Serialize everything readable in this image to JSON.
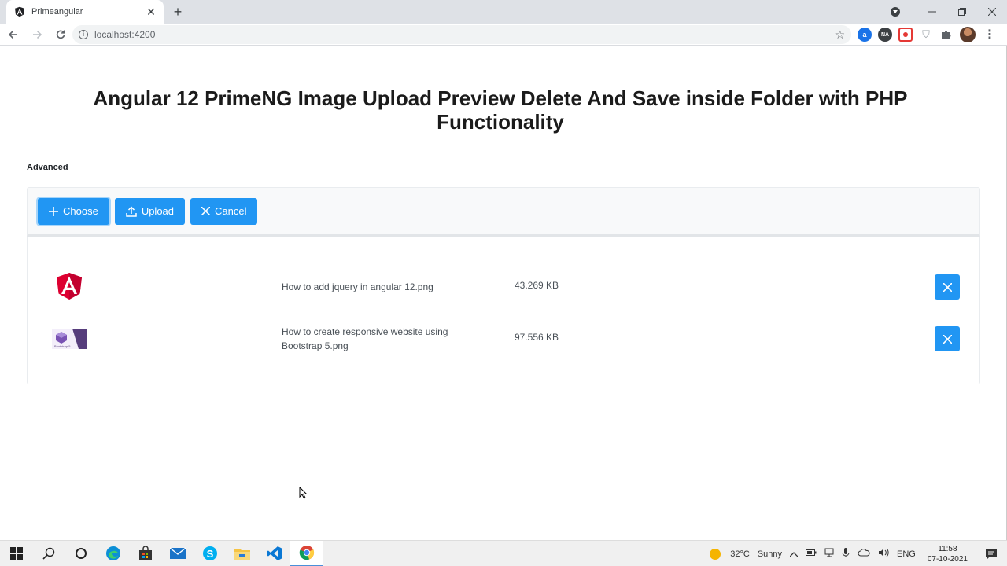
{
  "browser": {
    "tab_title": "Primeangular",
    "tab_close": "✕",
    "new_tab": "+",
    "url": "localhost:4200",
    "extensions": {
      "ext_a": "a",
      "ext_na": "NA"
    }
  },
  "page": {
    "title": "Angular 12 PrimeNG Image Upload Preview Delete And Save inside Folder with PHP Functionality",
    "section_label": "Advanced"
  },
  "fileupload": {
    "buttons": {
      "choose": "Choose",
      "upload": "Upload",
      "cancel": "Cancel"
    },
    "files": [
      {
        "name": "How to add jquery in angular 12.png",
        "size": "43.269 KB",
        "thumb": "angular-logo"
      },
      {
        "name": "How to create responsive website using Bootstrap 5.png",
        "size": "97.556 KB",
        "thumb": "bootstrap-thumb"
      }
    ],
    "bootstrap_thumb_caption": "Bootstrap 5"
  },
  "taskbar": {
    "weather_temp": "32°C",
    "weather_desc": "Sunny",
    "lang": "ENG",
    "time": "11:58",
    "date": "07-10-2021"
  },
  "colors": {
    "primary": "#2196f3",
    "focus_ring": "#a6d5fa",
    "angular_red": "#dd0031",
    "bootstrap_purple": "#563d7c"
  }
}
